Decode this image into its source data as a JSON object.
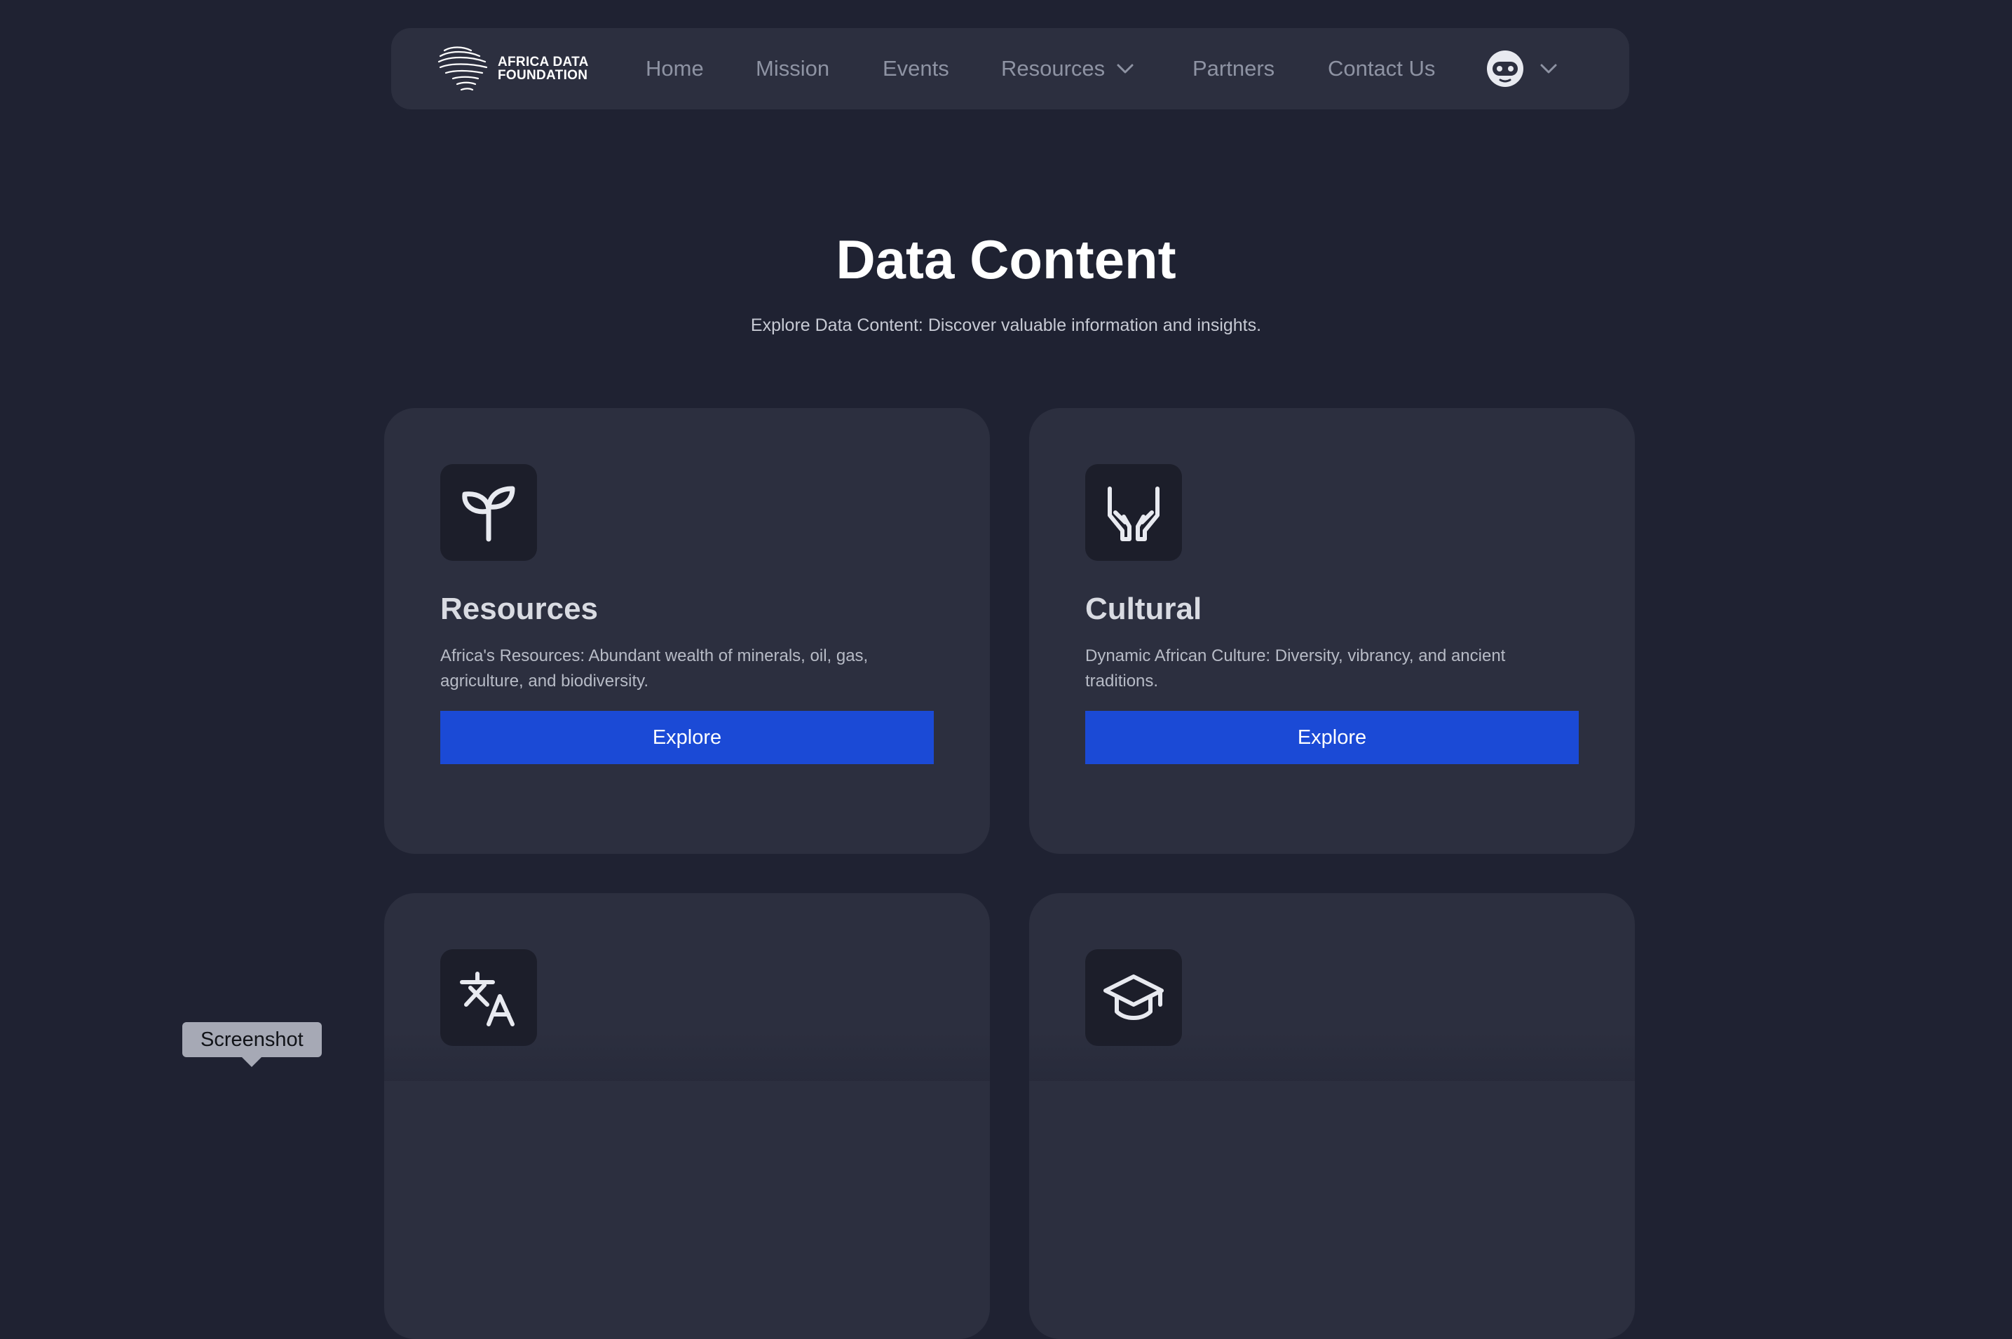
{
  "header": {
    "logo_line1": "AFRICA DATA",
    "logo_line2": "FOUNDATION",
    "nav": [
      {
        "label": "Home",
        "icon": ""
      },
      {
        "label": "Mission",
        "icon": ""
      },
      {
        "label": "Events",
        "icon": ""
      },
      {
        "label": "Resources",
        "icon": "chevron-down-icon"
      },
      {
        "label": "Partners",
        "icon": ""
      },
      {
        "label": "Contact Us",
        "icon": ""
      }
    ],
    "user_menu": {
      "avatar_icon": "robot-avatar-icon",
      "dropdown_icon": "chevron-down-icon"
    }
  },
  "main": {
    "title": "Data Content",
    "subtitle": "Explore Data Content: Discover valuable information and insights.",
    "cards": [
      {
        "icon": "sprout-icon",
        "title": "Resources",
        "description": "Africa's Resources: Abundant wealth of minerals, oil, gas, agriculture, and biodiversity.",
        "button_label": "Explore"
      },
      {
        "icon": "hands-icon",
        "title": "Cultural",
        "description": "Dynamic African Culture: Diversity, vibrancy, and ancient traditions.",
        "button_label": "Explore"
      },
      {
        "icon": "translate-icon",
        "title": "",
        "description": "",
        "button_label": ""
      },
      {
        "icon": "graduation-cap-icon",
        "title": "",
        "description": "",
        "button_label": ""
      }
    ]
  },
  "tooltip": {
    "text": "Screenshot"
  },
  "colors": {
    "background": "#1f2232",
    "card": "#2c2f3f",
    "icon_box": "#1c1e2a",
    "button": "#1b4ad6",
    "nav_text": "#8e93a3"
  }
}
